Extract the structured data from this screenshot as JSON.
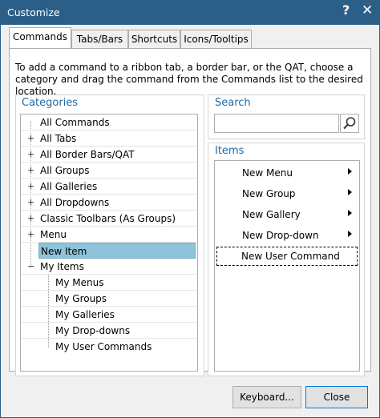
{
  "window": {
    "title": "Customize",
    "help_glyph": "?",
    "close_glyph": "✕"
  },
  "tabs": [
    {
      "label": "Commands",
      "active": true
    },
    {
      "label": "Tabs/Bars",
      "active": false
    },
    {
      "label": "Shortcuts",
      "active": false
    },
    {
      "label": "Icons/Tooltips",
      "active": false
    }
  ],
  "instructions": "To add a command to a ribbon tab, a border bar, or the QAT, choose a category and drag the command from the Commands list to the desired location.",
  "categories": {
    "label": "Categories",
    "items": [
      {
        "label": "All Commands",
        "expander": ""
      },
      {
        "label": "All Tabs",
        "expander": "+"
      },
      {
        "label": "All Border Bars/QAT",
        "expander": "+"
      },
      {
        "label": "All Groups",
        "expander": "+"
      },
      {
        "label": "All Galleries",
        "expander": "+"
      },
      {
        "label": "All Dropdowns",
        "expander": "+"
      },
      {
        "label": "Classic Toolbars (As Groups)",
        "expander": "+"
      },
      {
        "label": "Menu",
        "expander": "+"
      },
      {
        "label": "New Item",
        "expander": "",
        "selected": true
      },
      {
        "label": "My Items",
        "expander": "−"
      },
      {
        "label": "My Menus",
        "expander": "",
        "child": true
      },
      {
        "label": "My Groups",
        "expander": "",
        "child": true
      },
      {
        "label": "My Galleries",
        "expander": "",
        "child": true
      },
      {
        "label": "My Drop-downs",
        "expander": "",
        "child": true
      },
      {
        "label": "My User Commands",
        "expander": "",
        "child": true
      }
    ]
  },
  "search": {
    "label": "Search",
    "value": "",
    "icon": "magnifier-icon"
  },
  "items": {
    "label": "Items",
    "list": [
      {
        "label": "New Menu",
        "submenu": true
      },
      {
        "label": "New Group",
        "submenu": true
      },
      {
        "label": "New Gallery",
        "submenu": true
      },
      {
        "label": "New Drop-down",
        "submenu": true
      },
      {
        "label": "New User Command",
        "submenu": false,
        "focused": true
      }
    ]
  },
  "buttons": {
    "keyboard": "Keyboard...",
    "close": "Close"
  },
  "colors": {
    "titlebar": "#2b5f88",
    "accent_label": "#1e6aa6",
    "selection": "#8fc3d9"
  }
}
